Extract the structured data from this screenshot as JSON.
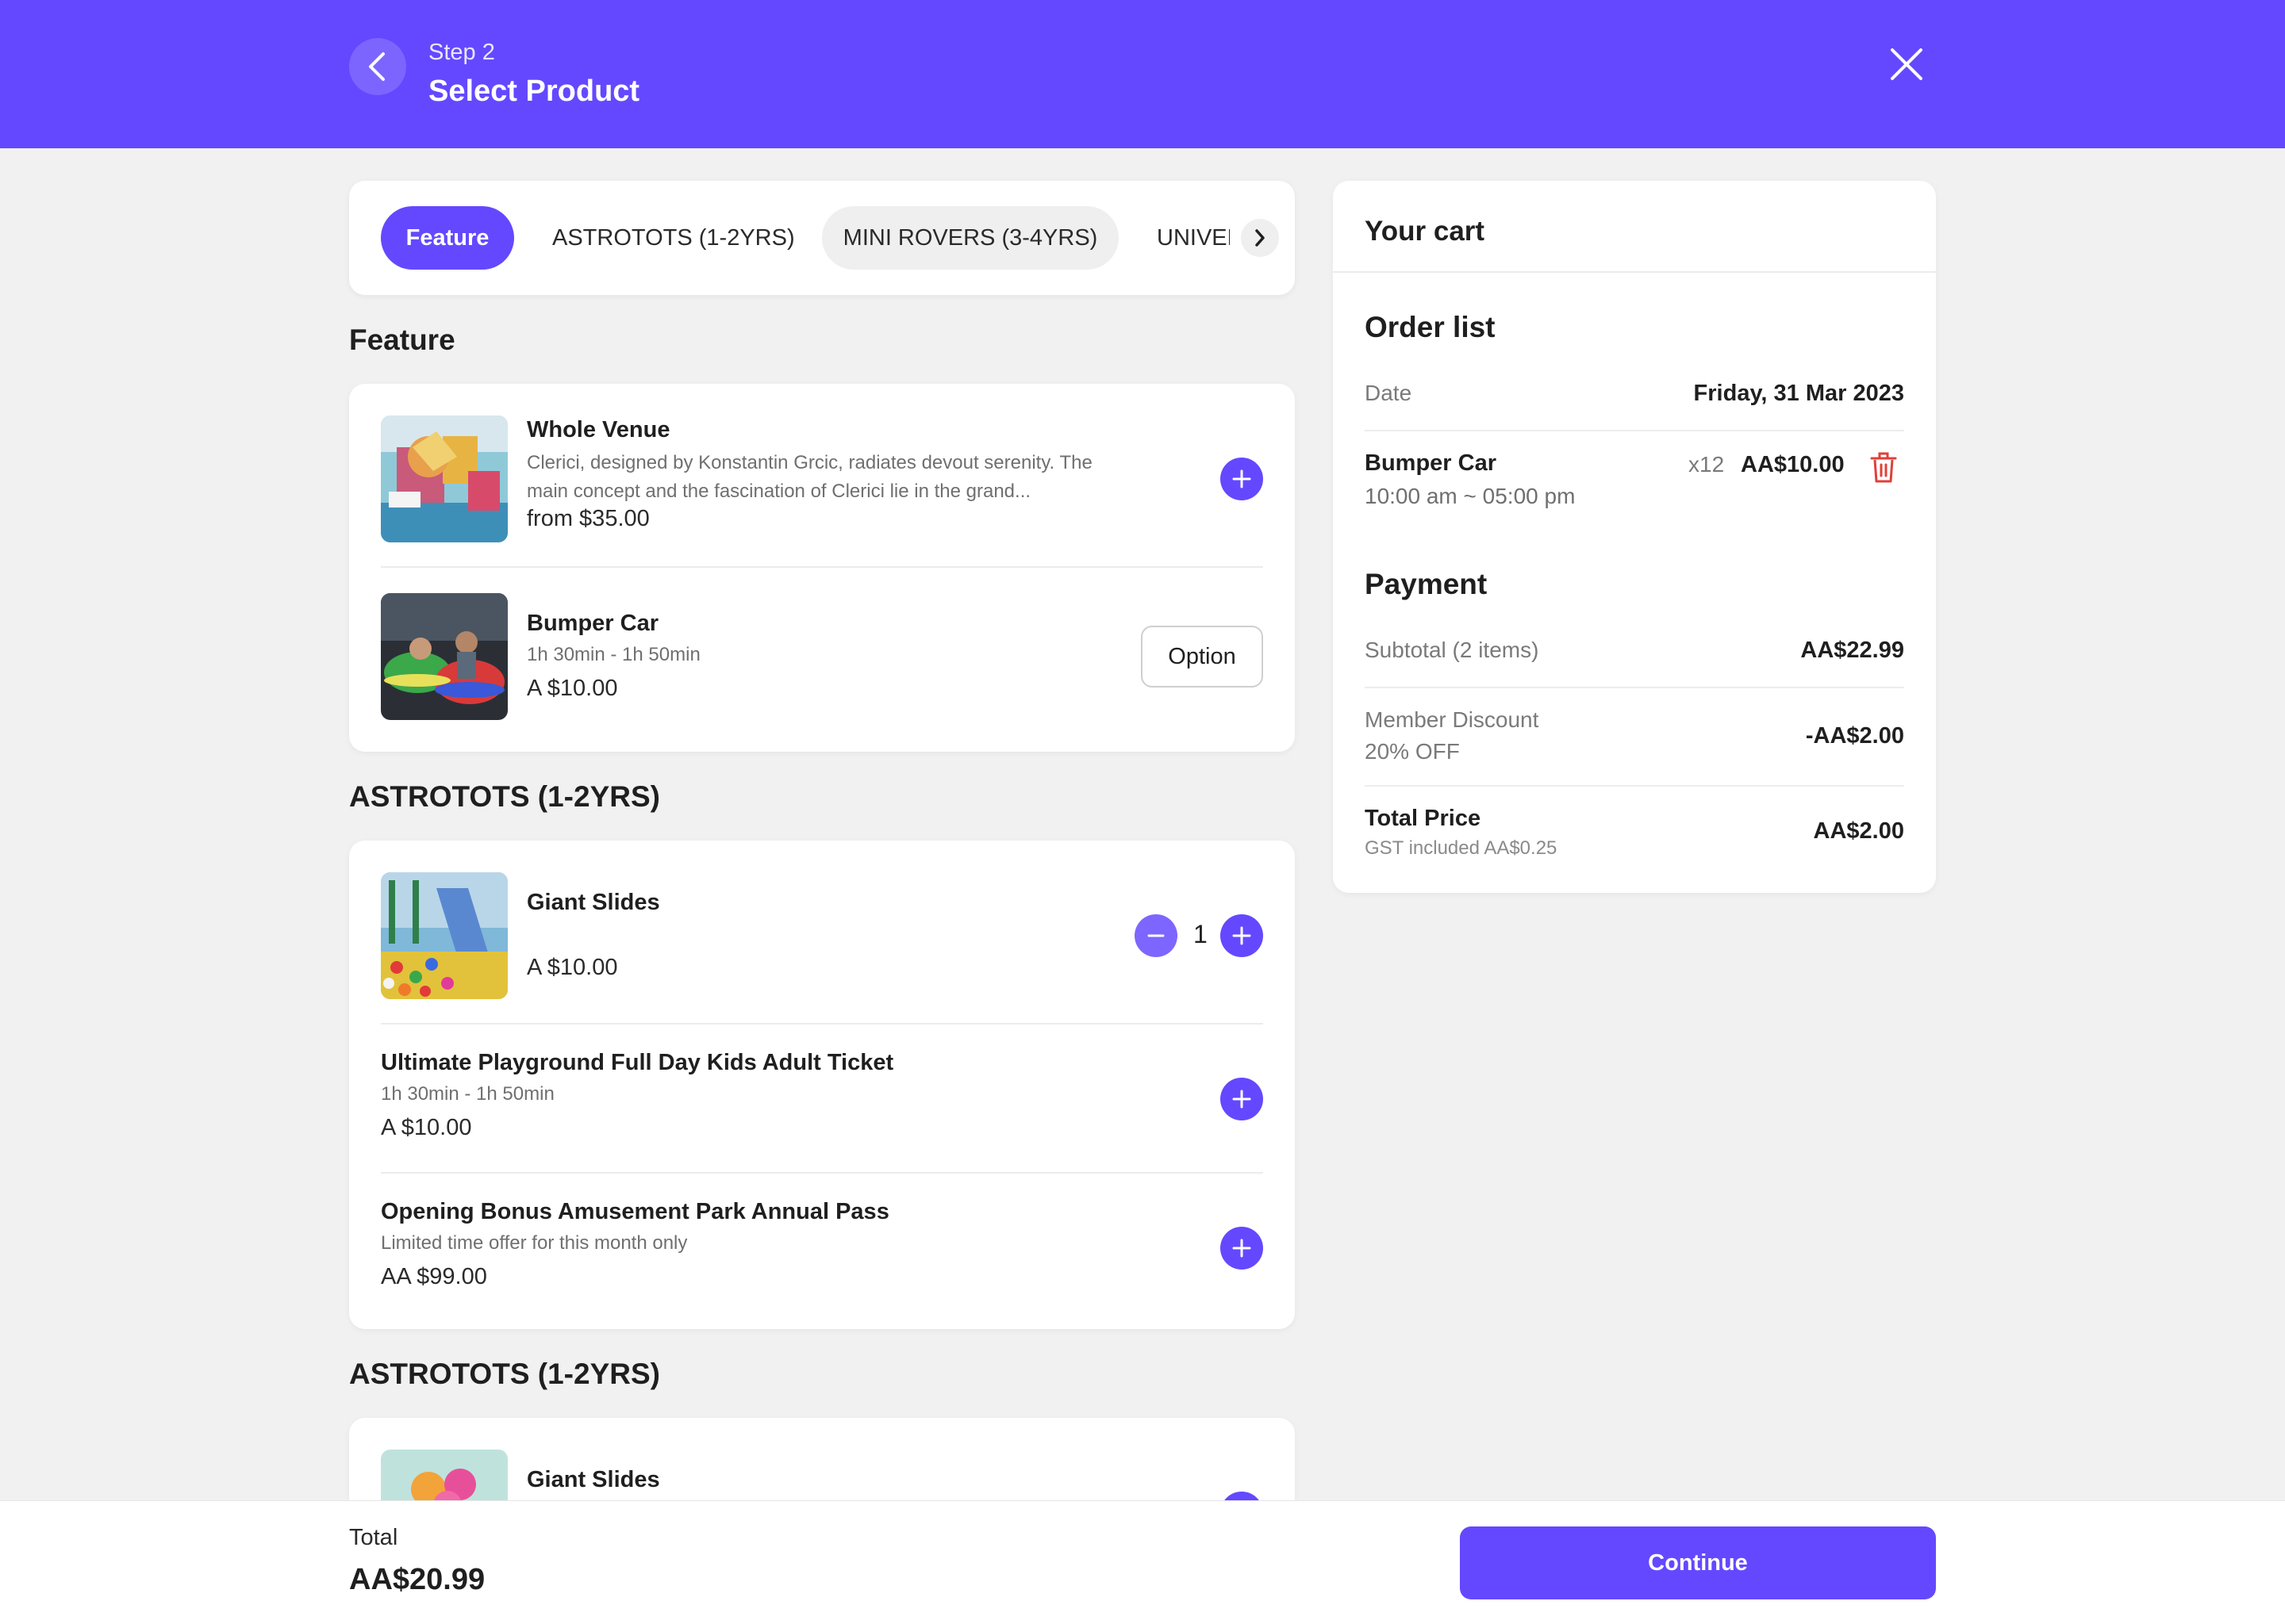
{
  "header": {
    "step": "Step 2",
    "title": "Select Product",
    "back_icon": "chevron-left-icon",
    "close_icon": "close-icon"
  },
  "tabs": [
    {
      "label": "Feature",
      "active": true
    },
    {
      "label": "ASTROTOTS (1-2YRS)",
      "active": false
    },
    {
      "label": "MINI ROVERS (3-4YRS)",
      "active": false
    },
    {
      "label": "UNIVERSE",
      "active": false
    }
  ],
  "sections": [
    {
      "title": "Feature",
      "items": [
        {
          "name": "Whole Venue",
          "description": "Clerici, designed by Konstantin Grcic, radiates devout serenity. The main concept and the fascination of Clerici lie in the grand...",
          "price": "from $35.00",
          "action": "add"
        },
        {
          "name": "Bumper Car",
          "subtitle": "1h 30min - 1h 50min",
          "price": "A $10.00",
          "action": "option",
          "option_label": "Option"
        }
      ]
    },
    {
      "title": "ASTROTOTS (1-2YRS)",
      "items": [
        {
          "name": "Giant Slides",
          "price": "A $10.00",
          "action": "stepper",
          "quantity": "1"
        },
        {
          "name": "Ultimate Playground Full Day Kids Adult Ticket",
          "subtitle": "1h 30min - 1h 50min",
          "price": "A $10.00",
          "action": "add"
        },
        {
          "name": "Opening Bonus Amusement Park Annual Pass",
          "subtitle": "Limited time offer for this month only",
          "price": "AA $99.00",
          "action": "add"
        }
      ]
    },
    {
      "title": "ASTROTOTS (1-2YRS)",
      "items": [
        {
          "name": "Giant Slides",
          "action": "add"
        }
      ]
    }
  ],
  "cart": {
    "title": "Your cart",
    "order_list_title": "Order list",
    "date_label": "Date",
    "date_value": "Friday, 31 Mar 2023",
    "line_item": {
      "name": "Bumper Car",
      "time": "10:00 am ~ 05:00 pm",
      "qty": "x12",
      "price": "AA$10.00",
      "delete_icon": "trash-icon"
    },
    "payment_title": "Payment",
    "subtotal_label": "Subtotal (2 items)",
    "subtotal_value": "AA$22.99",
    "discount_label": "Member Discount",
    "discount_sub": "20% OFF",
    "discount_value": "-AA$2.00",
    "total_label": "Total Price",
    "gst": "GST included AA$0.25",
    "total_value": "AA$2.00"
  },
  "footer": {
    "total_label": "Total",
    "total_value": "AA$20.99",
    "continue_label": "Continue"
  },
  "colors": {
    "accent": "#6448ff",
    "danger": "#e0403a"
  }
}
